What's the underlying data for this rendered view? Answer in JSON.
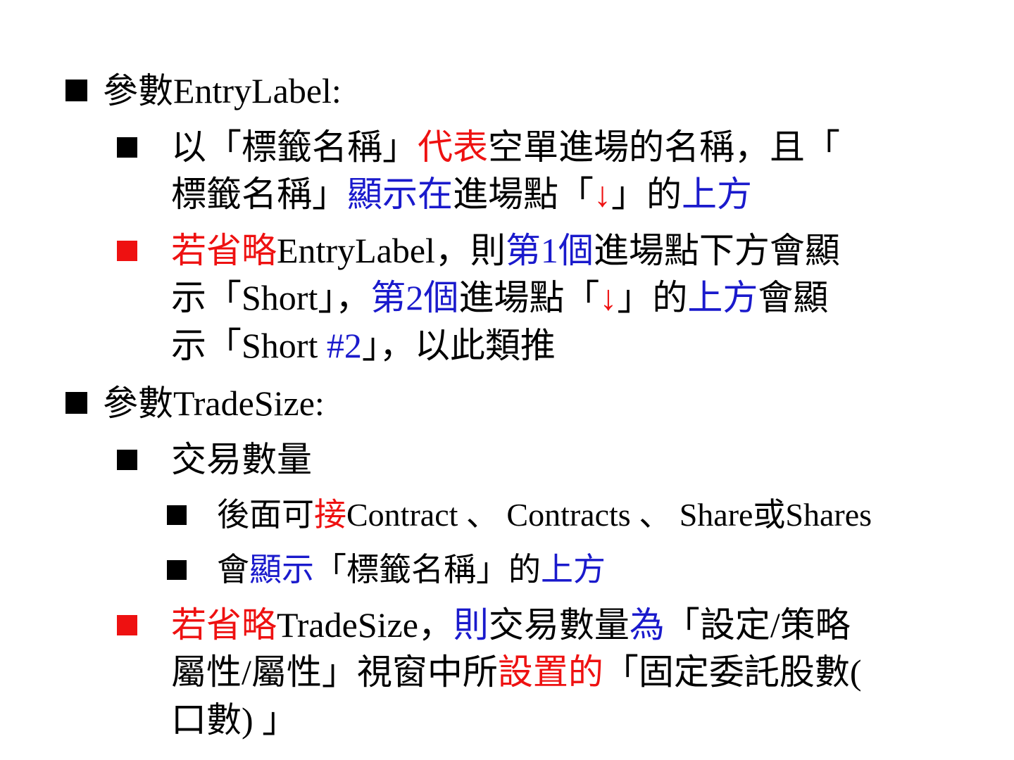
{
  "colors": {
    "text": "#000000",
    "red": "#ee1111",
    "blue": "#1a1acc"
  },
  "items": [
    {
      "segments": [
        {
          "text": "參數EntryLabel:",
          "color": "black"
        }
      ]
    },
    {
      "bullet_color": "black",
      "lines": [
        [
          {
            "text": "以「標籤名稱」",
            "color": "black"
          },
          {
            "text": "代表",
            "color": "red"
          },
          {
            "text": "空單進場的名稱，且「",
            "color": "black"
          }
        ],
        [
          {
            "text": "標籤名稱」",
            "color": "black"
          },
          {
            "text": "顯示在",
            "color": "blue"
          },
          {
            "text": "進場點「",
            "color": "black"
          },
          {
            "text": "↓",
            "color": "red"
          },
          {
            "text": "」的",
            "color": "black"
          },
          {
            "text": "上方",
            "color": "blue"
          }
        ]
      ]
    },
    {
      "bullet_color": "red",
      "lines": [
        [
          {
            "text": "若省略",
            "color": "red"
          },
          {
            "text": "EntryLabel，則",
            "color": "black"
          },
          {
            "text": "第1個",
            "color": "blue"
          },
          {
            "text": "進場點下方會顯",
            "color": "black"
          }
        ],
        [
          {
            "text": "示「Short」，",
            "color": "black"
          },
          {
            "text": "第2個",
            "color": "blue"
          },
          {
            "text": "進場點「",
            "color": "black"
          },
          {
            "text": "↓",
            "color": "red"
          },
          {
            "text": "」的",
            "color": "black"
          },
          {
            "text": "上方",
            "color": "blue"
          },
          {
            "text": "會顯",
            "color": "black"
          }
        ],
        [
          {
            "text": "示「Short ",
            "color": "black"
          },
          {
            "text": "#2",
            "color": "blue"
          },
          {
            "text": "」，以此類推",
            "color": "black"
          }
        ]
      ]
    },
    {
      "segments": [
        {
          "text": "參數TradeSize:",
          "color": "black"
        }
      ]
    },
    {
      "bullet_color": "black",
      "lines": [
        [
          {
            "text": "交易數量",
            "color": "black"
          }
        ]
      ]
    },
    {
      "segments": [
        {
          "text": "後面可",
          "color": "black"
        },
        {
          "text": "接",
          "color": "red"
        },
        {
          "text": "Contract 、 Contracts 、 Share或Shares",
          "color": "black"
        }
      ]
    },
    {
      "segments": [
        {
          "text": "會",
          "color": "black"
        },
        {
          "text": "顯示",
          "color": "blue"
        },
        {
          "text": "「標籤名稱」的",
          "color": "black"
        },
        {
          "text": "上方",
          "color": "blue"
        }
      ]
    },
    {
      "bullet_color": "red",
      "lines": [
        [
          {
            "text": "若省略",
            "color": "red"
          },
          {
            "text": "TradeSize，",
            "color": "black"
          },
          {
            "text": "則",
            "color": "blue"
          },
          {
            "text": "交易數量",
            "color": "black"
          },
          {
            "text": "為",
            "color": "blue"
          },
          {
            "text": "「設定/策略",
            "color": "black"
          }
        ],
        [
          {
            "text": "屬性/屬性」視窗中所",
            "color": "black"
          },
          {
            "text": "設置的",
            "color": "red"
          },
          {
            "text": "「固定委託股數(",
            "color": "black"
          }
        ],
        [
          {
            "text": "口數) 」",
            "color": "black"
          }
        ]
      ]
    }
  ]
}
